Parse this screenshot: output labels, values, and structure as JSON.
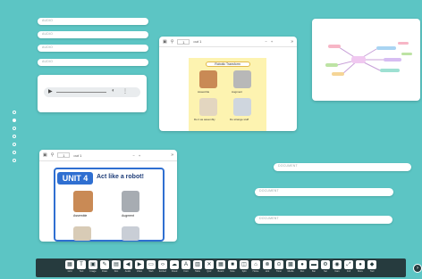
{
  "audio_pills": [
    "AUDIO",
    "AUDIO",
    "AUDIO",
    "AUDIO"
  ],
  "document_pills": [
    "DOCUMENT",
    "DOCUMENT",
    "DOCUMENT"
  ],
  "pdf_small": {
    "page": "1",
    "total": "out 1",
    "minus": "−",
    "plus": "+",
    "heading": "Robotic Transform",
    "labels": [
      "Assemble",
      "Augment",
      "Do it as assembly",
      "Do strange stuff"
    ]
  },
  "pdf_large": {
    "page": "1",
    "total": "out 1",
    "minus": "−",
    "plus": "+",
    "unit": "UNIT 4",
    "title": "Act like a robot!",
    "labels": [
      "Assemble",
      "Assemble",
      "Augment",
      "Augment"
    ]
  },
  "tools": [
    {
      "icon": "▦",
      "label": "Grid"
    },
    {
      "icon": "T",
      "label": "Text"
    },
    {
      "icon": "▣",
      "label": "Image"
    },
    {
      "icon": "✎",
      "label": "Draw"
    },
    {
      "icon": "▤",
      "label": "Doc"
    },
    {
      "icon": "◀",
      "label": "Audio"
    },
    {
      "icon": "▶",
      "label": "Video"
    },
    {
      "icon": "▭",
      "label": "Web"
    },
    {
      "icon": "‹›",
      "label": "Embed"
    },
    {
      "icon": "☁",
      "label": "Cloud"
    },
    {
      "icon": "A",
      "label": "Font"
    },
    {
      "icon": "▥",
      "label": "Table"
    },
    {
      "icon": "✕",
      "label": "Quiz"
    },
    {
      "icon": "▦",
      "label": "Board"
    },
    {
      "icon": "■",
      "label": "Note"
    },
    {
      "icon": "◫",
      "label": "Split"
    },
    {
      "icon": "⌂",
      "label": "Home"
    },
    {
      "icon": "⊗",
      "label": "Link"
    },
    {
      "icon": "⊙",
      "label": "Timer"
    },
    {
      "icon": "▩",
      "label": "Media"
    },
    {
      "icon": "●",
      "label": "Rec"
    },
    {
      "icon": "▬",
      "label": "Bar"
    },
    {
      "icon": "⚙",
      "label": "Set"
    },
    {
      "icon": "◉",
      "label": "Cam"
    },
    {
      "icon": "⤢",
      "label": "Full"
    },
    {
      "icon": "●",
      "label": "More"
    },
    {
      "icon": "◆",
      "label": "Tool"
    }
  ],
  "fab": "›"
}
